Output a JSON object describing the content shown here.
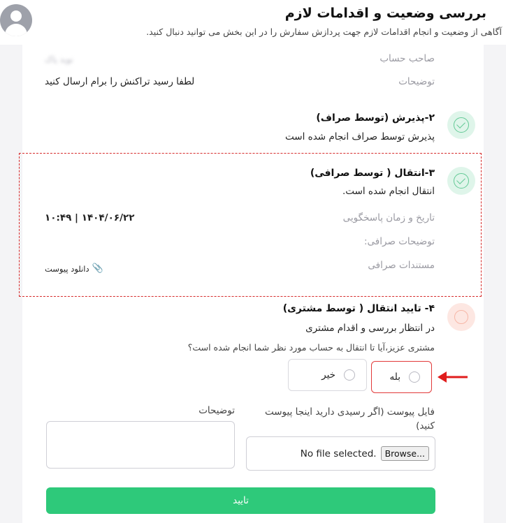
{
  "header": {
    "title": "بررسی وضعیت و اقدامات لازم",
    "subtitle": "آگاهی از وضعیت و انجام اقدامات لازم جهت پردازش سفارش را در این بخش می توانید دنبال کنید."
  },
  "account": {
    "owner_label": "صاحب حساب",
    "owner_value": "نوید پاک",
    "notes_label": "توضیحات",
    "notes_value": "لطفا رسید تراکنش را برام ارسال کنید"
  },
  "steps": [
    {
      "title": "۲-پذیرش (توسط صراف)",
      "desc": "پذیرش توسط صراف انجام شده است",
      "status": "done"
    },
    {
      "title": "۳-انتقال ( توسط صرافی)",
      "desc": "انتقال انجام شده است.",
      "status": "done",
      "response_time_label": "تاریخ و زمان پاسخگویی",
      "response_time_value": "۱۴۰۴/۰۶/۲۲ | ۱۰:۴۹",
      "exchange_notes_label": "توضیحات صرافی:",
      "documents_label": "مستندات صرافی",
      "download_label": "دانلود پیوست"
    },
    {
      "title": "۴- تایید انتقال ( توسط مشتری)",
      "desc": "در انتظار بررسی و اقدام مشتری",
      "status": "pending",
      "question": "مشتری عزیز،آیا تا انتقال به حساب مورد نظر شما انجام شده است؟",
      "options": [
        "بله",
        "خیر"
      ]
    }
  ],
  "form": {
    "attachment_label": "فایل پیوست (اگر رسیدی دارید اینجا پیوست کنید)",
    "notes_label": "توضیحات",
    "browse_label": "Browse...",
    "file_status": "No file selected.",
    "submit_label": "تایید"
  },
  "colors": {
    "accent_green": "#2ec97a",
    "highlight_red": "#d62b2b"
  }
}
